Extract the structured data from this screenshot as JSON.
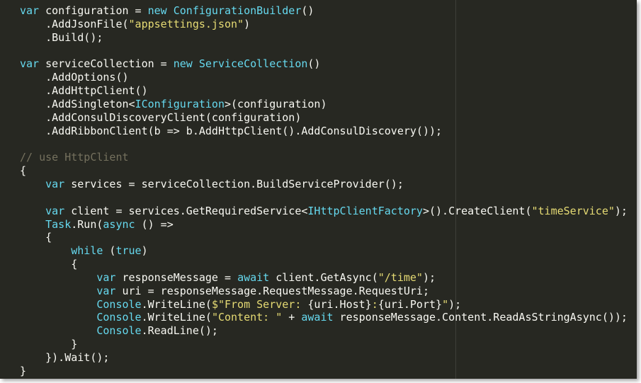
{
  "editor": {
    "language": "csharp",
    "theme_colors": {
      "background": "#272822",
      "text": "#f8f8f2",
      "keyword": "#66d9ef",
      "type": "#66d9ef",
      "string": "#e6db74",
      "comment": "#75715e"
    },
    "lines": [
      [
        {
          "t": "kw",
          "v": "var"
        },
        {
          "t": "plain",
          "v": " configuration = "
        },
        {
          "t": "kw",
          "v": "new"
        },
        {
          "t": "plain",
          "v": " "
        },
        {
          "t": "type",
          "v": "ConfigurationBuilder"
        },
        {
          "t": "plain",
          "v": "()"
        }
      ],
      [
        {
          "t": "plain",
          "v": "    .AddJsonFile("
        },
        {
          "t": "str",
          "v": "\"appsettings.json\""
        },
        {
          "t": "plain",
          "v": ")"
        }
      ],
      [
        {
          "t": "plain",
          "v": "    .Build();"
        }
      ],
      [],
      [
        {
          "t": "kw",
          "v": "var"
        },
        {
          "t": "plain",
          "v": " serviceCollection = "
        },
        {
          "t": "kw",
          "v": "new"
        },
        {
          "t": "plain",
          "v": " "
        },
        {
          "t": "type",
          "v": "ServiceCollection"
        },
        {
          "t": "plain",
          "v": "()"
        }
      ],
      [
        {
          "t": "plain",
          "v": "    .AddOptions()"
        }
      ],
      [
        {
          "t": "plain",
          "v": "    .AddHttpClient()"
        }
      ],
      [
        {
          "t": "plain",
          "v": "    .AddSingleton<"
        },
        {
          "t": "type",
          "v": "IConfiguration"
        },
        {
          "t": "plain",
          "v": ">(configuration)"
        }
      ],
      [
        {
          "t": "plain",
          "v": "    .AddConsulDiscoveryClient(configuration)"
        }
      ],
      [
        {
          "t": "plain",
          "v": "    .AddRibbonClient(b => b.AddHttpClient().AddConsulDiscovery());"
        }
      ],
      [],
      [
        {
          "t": "com",
          "v": "// use HttpClient"
        }
      ],
      [
        {
          "t": "plain",
          "v": "{"
        }
      ],
      [
        {
          "t": "plain",
          "v": "    "
        },
        {
          "t": "kw",
          "v": "var"
        },
        {
          "t": "plain",
          "v": " services = serviceCollection.BuildServiceProvider();"
        }
      ],
      [],
      [
        {
          "t": "plain",
          "v": "    "
        },
        {
          "t": "kw",
          "v": "var"
        },
        {
          "t": "plain",
          "v": " client = services.GetRequiredService<"
        },
        {
          "t": "type",
          "v": "IHttpClientFactory"
        },
        {
          "t": "plain",
          "v": ">().CreateClient("
        },
        {
          "t": "str",
          "v": "\"timeService\""
        },
        {
          "t": "plain",
          "v": ");"
        }
      ],
      [
        {
          "t": "plain",
          "v": "    "
        },
        {
          "t": "type",
          "v": "Task"
        },
        {
          "t": "plain",
          "v": ".Run("
        },
        {
          "t": "kw",
          "v": "async"
        },
        {
          "t": "plain",
          "v": " () =>"
        }
      ],
      [
        {
          "t": "plain",
          "v": "    {"
        }
      ],
      [
        {
          "t": "plain",
          "v": "        "
        },
        {
          "t": "kw",
          "v": "while"
        },
        {
          "t": "plain",
          "v": " ("
        },
        {
          "t": "kw",
          "v": "true"
        },
        {
          "t": "plain",
          "v": ")"
        }
      ],
      [
        {
          "t": "plain",
          "v": "        {"
        }
      ],
      [
        {
          "t": "plain",
          "v": "            "
        },
        {
          "t": "kw",
          "v": "var"
        },
        {
          "t": "plain",
          "v": " responseMessage = "
        },
        {
          "t": "kw",
          "v": "await"
        },
        {
          "t": "plain",
          "v": " client.GetAsync("
        },
        {
          "t": "str",
          "v": "\"/time\""
        },
        {
          "t": "plain",
          "v": ");"
        }
      ],
      [
        {
          "t": "plain",
          "v": "            "
        },
        {
          "t": "kw",
          "v": "var"
        },
        {
          "t": "plain",
          "v": " uri = responseMessage.RequestMessage.RequestUri;"
        }
      ],
      [
        {
          "t": "plain",
          "v": "            "
        },
        {
          "t": "type",
          "v": "Console"
        },
        {
          "t": "plain",
          "v": ".WriteLine("
        },
        {
          "t": "str",
          "v": "$\"From Server: "
        },
        {
          "t": "plain",
          "v": "{uri.Host}"
        },
        {
          "t": "str",
          "v": ":"
        },
        {
          "t": "plain",
          "v": "{uri.Port}"
        },
        {
          "t": "str",
          "v": "\""
        },
        {
          "t": "plain",
          "v": ");"
        }
      ],
      [
        {
          "t": "plain",
          "v": "            "
        },
        {
          "t": "type",
          "v": "Console"
        },
        {
          "t": "plain",
          "v": ".WriteLine("
        },
        {
          "t": "str",
          "v": "\"Content: \""
        },
        {
          "t": "plain",
          "v": " + "
        },
        {
          "t": "kw",
          "v": "await"
        },
        {
          "t": "plain",
          "v": " responseMessage.Content.ReadAsStringAsync());"
        }
      ],
      [
        {
          "t": "plain",
          "v": "            "
        },
        {
          "t": "type",
          "v": "Console"
        },
        {
          "t": "plain",
          "v": ".ReadLine();"
        }
      ],
      [
        {
          "t": "plain",
          "v": "        }"
        }
      ],
      [
        {
          "t": "plain",
          "v": "    }).Wait();"
        }
      ],
      [
        {
          "t": "plain",
          "v": "}"
        }
      ]
    ]
  }
}
